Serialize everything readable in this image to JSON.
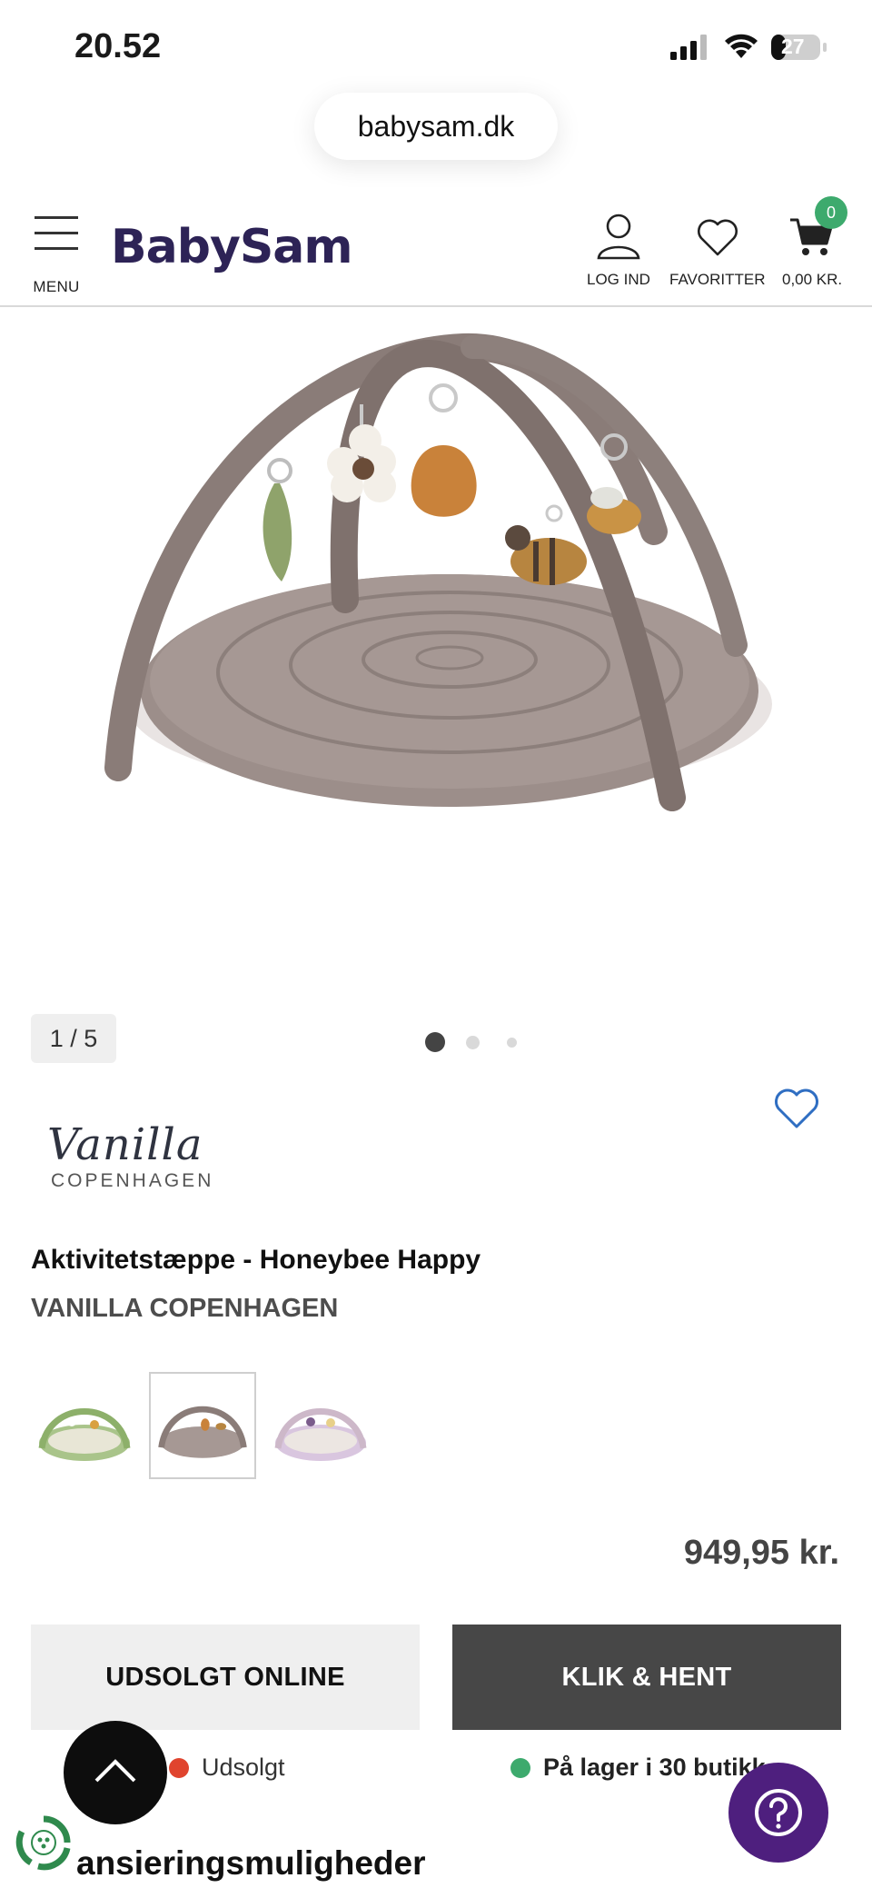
{
  "status_bar": {
    "time": "20.52",
    "battery": "27"
  },
  "browser": {
    "url": "babysam.dk"
  },
  "header": {
    "menu_label": "MENU",
    "logo": "BabySam",
    "login_label": "LOG IND",
    "favorites_label": "FAVORITTER",
    "cart_label": "0,00 KR.",
    "cart_count": "0"
  },
  "gallery": {
    "counter": "1 / 5",
    "dots": 3,
    "active_dot": 0
  },
  "product": {
    "brand_logo_script": "Vanilla",
    "brand_logo_sub": "COPENHAGEN",
    "title": "Aktivitetstæppe - Honeybee Happy",
    "brand": "VANILLA COPENHAGEN",
    "variants": [
      {
        "color": "green",
        "selected": false
      },
      {
        "color": "taupe",
        "selected": true
      },
      {
        "color": "lilac",
        "selected": false
      }
    ],
    "price": "949,95 kr."
  },
  "actions": {
    "online_button": "UDSOLGT ONLINE",
    "pickup_button": "KLIK & HENT",
    "online_status": "Udsolgt",
    "store_status": "På lager i 30 butikk"
  },
  "section": {
    "finance_heading": "ansieringsmuligheder"
  },
  "colors": {
    "brand": "#2d2356",
    "badge": "#3daa6d",
    "soldout_dot": "#e0442e",
    "instock_dot": "#3daa6d",
    "help_button": "#4e1f7e",
    "favorite_heart": "#2f6ec2"
  }
}
